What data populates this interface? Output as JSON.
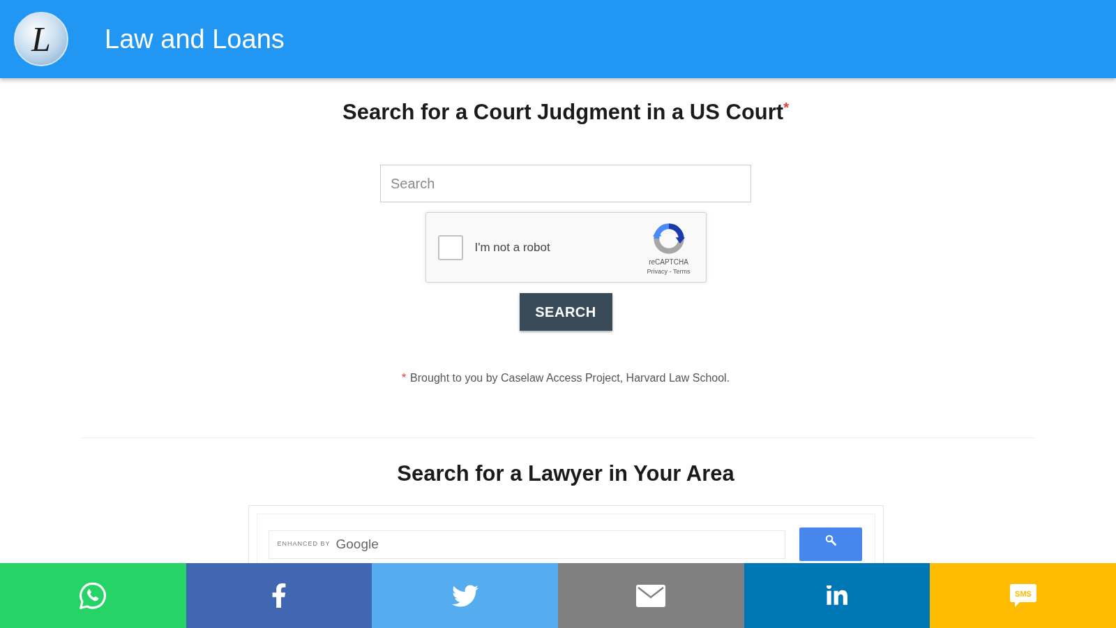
{
  "header": {
    "logo_text": "L",
    "title": "Law and Loans"
  },
  "judgment_search": {
    "heading": "Search for a Court Judgment in a US Court$^{*}$",
    "search_field": {
      "placeholder": "Search"
    },
    "captcha": {
      "checked": false,
      "label": "I'm not a robot",
      "brand": "reCAPTCHA",
      "links": "Privacy - Terms"
    },
    "button": "SEARCH",
    "footnote": {
      "mark": "*",
      "text": "Brought to you by Caselaw Access Project, Harvard Law School."
    }
  },
  "lawyer_search": {
    "heading": "Search for a Lawyer in Your Area",
    "enhanced_by": "ENHANCED BY",
    "brand": "Google"
  },
  "share_bar": [
    {
      "kind": "whatsapp",
      "color": "#25d366"
    },
    {
      "kind": "facebook",
      "color": "#4267b2"
    },
    {
      "kind": "twitter",
      "color": "#55acee"
    },
    {
      "kind": "email",
      "color": "#808080"
    },
    {
      "kind": "linkedin",
      "color": "#0077b5"
    },
    {
      "kind": "sms",
      "color": "#ffbb00",
      "label": "SMS"
    }
  ]
}
